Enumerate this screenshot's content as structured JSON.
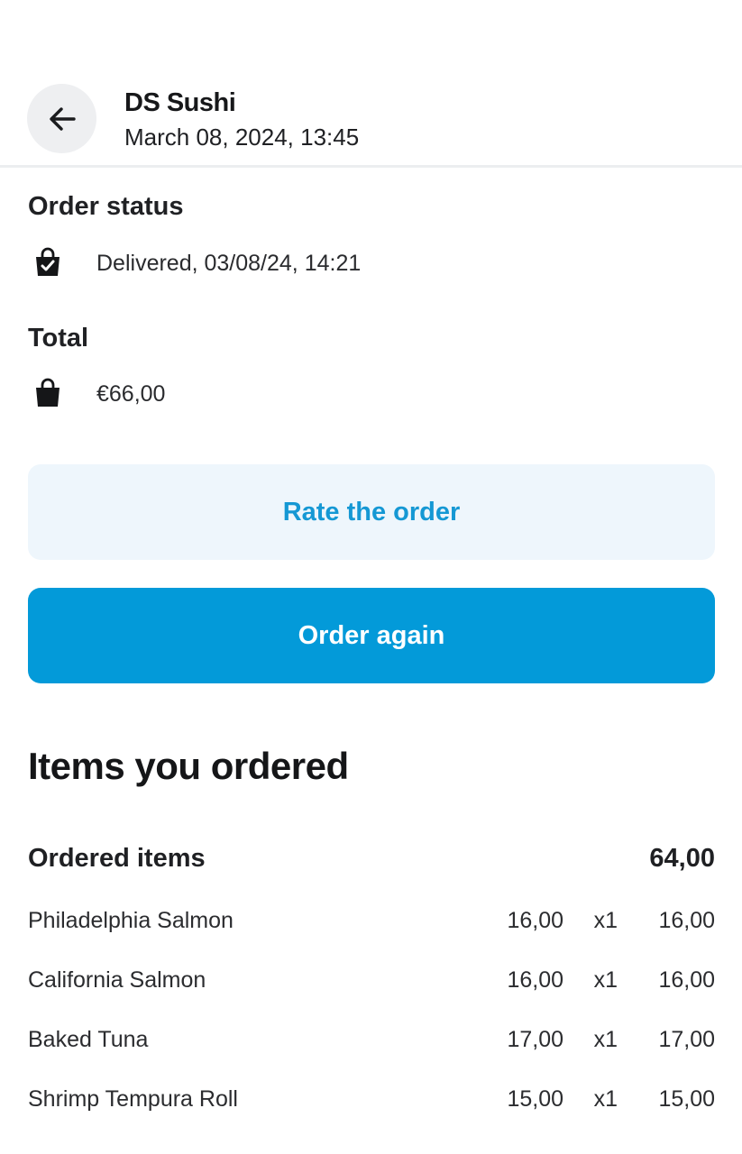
{
  "header": {
    "back_icon": "arrow-left-icon",
    "restaurant": "DS Sushi",
    "date": "March 08, 2024, 13:45"
  },
  "status": {
    "title": "Order status",
    "icon": "bag-check-icon",
    "text": "Delivered, 03/08/24, 14:21"
  },
  "total": {
    "title": "Total",
    "icon": "bag-icon",
    "value": "€66,00"
  },
  "actions": {
    "rate_label": "Rate the order",
    "again_label": "Order again"
  },
  "items": {
    "heading": "Items you ordered",
    "summary_label": "Ordered items",
    "summary_total": "64,00",
    "rows": [
      {
        "name": "Philadelphia Salmon",
        "price": "16,00",
        "qty": "x1",
        "sum": "16,00"
      },
      {
        "name": "California Salmon",
        "price": "16,00",
        "qty": "x1",
        "sum": "16,00"
      },
      {
        "name": "Baked Tuna",
        "price": "17,00",
        "qty": "x1",
        "sum": "17,00"
      },
      {
        "name": "Shrimp Tempura Roll",
        "price": "15,00",
        "qty": "x1",
        "sum": "15,00"
      }
    ]
  },
  "colors": {
    "accent": "#039ad9",
    "accent_light": "#eef6fc",
    "accent_text": "#1598d4"
  }
}
